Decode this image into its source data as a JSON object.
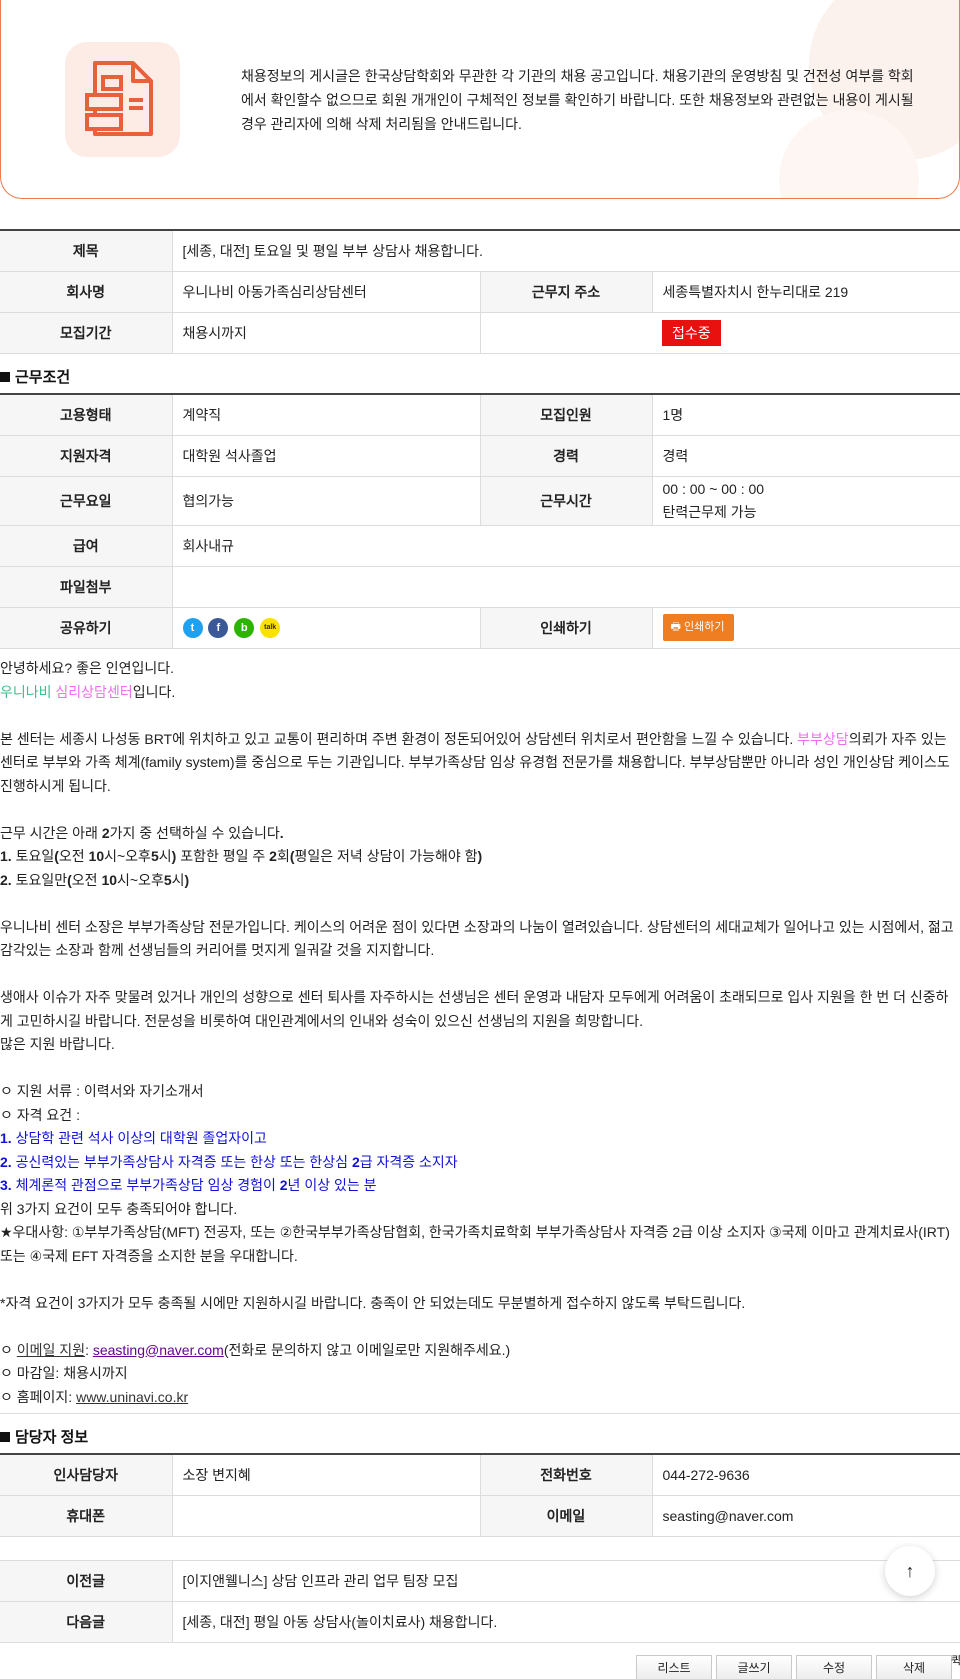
{
  "notice": {
    "icon": "document-list-icon",
    "text": "채용정보의 게시글은 한국상담학회와 무관한 각 기관의 채용 공고입니다. 채용기관의 운영방침 및 건전성 여부를 학회에서 확인할수 없으므로 회원 개개인이 구체적인 정보를 확인하기 바랍니다. 또한 채용정보와 관련없는 내용이 게시될 경우 관리자에 의해 삭제 처리됨을 안내드립니다."
  },
  "post": {
    "title_label": "제목",
    "title": "[세종, 대전] 토요일 및 평일 부부 상담사 채용합니다.",
    "company_label": "회사명",
    "company": "우니나비 아동가족심리상담센터",
    "address_label": "근무지 주소",
    "address": "세종특별자치시 한누리대로 219",
    "period_label": "모집기간",
    "period": "채용시까지",
    "status": "접수중",
    "status_color": "#e8110f"
  },
  "conditions": {
    "section_title": "근무조건",
    "employment_type_label": "고용형태",
    "employment_type": "계약직",
    "headcount_label": "모집인원",
    "headcount": "1명",
    "qualification_label": "지원자격",
    "qualification": "대학원 석사졸업",
    "career_label": "경력",
    "career": "경력",
    "workdays_label": "근무요일",
    "workdays": "협의가능",
    "worktime_label": "근무시간",
    "worktime": "00 : 00 ~ 00 : 00",
    "worktime_note": "탄력근무제 가능",
    "salary_label": "급여",
    "salary": "회사내규",
    "attachment_label": "파일첨부",
    "share_label": "공유하기",
    "share_icons": [
      "twitter-icon",
      "facebook-icon",
      "band-icon",
      "kakaotalk-icon"
    ],
    "print_label": "인쇄하기",
    "print_button": "인쇄하기",
    "print_color": "#ef7d22"
  },
  "body": {
    "greeting": "안녕하세요? 좋은 인연입니다.",
    "center_name_green": "우니나비",
    "center_name_pink": " 심리상담센터",
    "center_name_suffix": "입니다.",
    "intro_1": "본 센터는 세종시 나성동 BRT에 위치하고 있고 교통이 편리하며 주변 환경이 정돈되어있어 상담센터 위치로서 편안함을 느낄 수 있습니다. ",
    "intro_pink": "부부상담",
    "intro_2": "의뢰가 자주 있는 센터로 부부와 가족 체계(family system)를 중심으로 두는 기관입니다. 부부가족상담 임상 유경험 전문가를 채용합니다. 부부상담뿐만 아니라 성인 개인상담 케이스도 진행하시게 됩니다.",
    "hours_intro_a": "근무 시간은 아래 ",
    "hours_intro_b": "2",
    "hours_intro_c": "가지 중 선택하실 수 있습니다",
    "hours_intro_d": ".",
    "option1_a": "1. ",
    "option1_b": "토요일",
    "option1_c": "(",
    "option1_d": "오전 ",
    "option1_e": "10",
    "option1_f": "시~오후",
    "option1_g": "5",
    "option1_h": "시",
    "option1_i": ") ",
    "option1_j": "포함한 평일 주 ",
    "option1_k": "2",
    "option1_l": "회",
    "option1_m": "(",
    "option1_n": "평일은 저녁 상담이 가능해야 함",
    "option1_o": ")",
    "option2_a": "2. ",
    "option2_b": "토요일만",
    "option2_c": "(",
    "option2_d": "오전 ",
    "option2_e": "10",
    "option2_f": "시~오후",
    "option2_g": "5",
    "option2_h": "시",
    "option2_i": ")",
    "director": "우니나비 센터 소장은 부부가족상담 전문가입니다. 케이스의 어려운 점이 있다면 소장과의 나눔이 열려있습니다. 상담센터의 세대교체가 일어나고 있는 시점에서, 젊고 감각있는 소장과 함께 선생님들의 커리어를 멋지게 일궈갈 것을 지지합니다.",
    "caution": "생애사 이슈가 자주 맞물려 있거나 개인의 성향으로 센터 퇴사를 자주하시는 선생님은 센터 운영과 내담자 모두에게 어려움이 초래되므로 입사 지원을 한 번 더 신중하게 고민하시길 바랍니다. 전문성을 비롯하여 대인관계에서의 인내와 성숙이 있으신 선생님의 지원을 희망합니다.",
    "closing": "많은 지원 바랍니다.",
    "docs": "ㅇ 지원 서류 : 이력서와 자기소개서",
    "requirements_title": "ㅇ 자격 요건 :",
    "req1_num": "1.",
    "req1_text": " 상담학 관련 석사 이상의 대학원 졸업자이고",
    "req2_num": "2.",
    "req2_text_a": " 공신력있는 부부가족상담사 자격증 또는 한상 또는 한상심 ",
    "req2_text_b": "2",
    "req2_text_c": "급 자격증 소지자",
    "req3_num": "3.",
    "req3_text_a": " 체계론적 관점으로 부부가족상담 임상 경험이 ",
    "req3_text_b": "2",
    "req3_text_c": "년 이상 있는 분",
    "req_all": "위 3가지 요건이 모두 충족되어야 합니다.",
    "preference": "★우대사항: ①부부가족상담(MFT) 전공자, 또는 ②한국부부가족상담협회, 한국가족치료학회 부부가족상담사 자격증 2급 이상 소지자 ③국제 이마고 관계치료사(IRT) 또는 ④국제 EFT 자격증을 소지한 분을 우대합니다.",
    "note": "*자격 요건이 3가지가 모두 충족될 시에만 지원하시길 바랍니다. 충족이 안 되었는데도 무분별하게 접수하지 않도록 부탁드립니다.",
    "email_prefix": "ㅇ ",
    "email_label": "이메일 지원",
    "email_colon": ": ",
    "email_link": "seasting@naver.com",
    "email_note": "(전화로 문의하지 않고 이메일로만 지원해주세요.)",
    "deadline": "ㅇ 마감일: 채용시까지",
    "homepage_prefix": "ㅇ 홈페이지: ",
    "homepage_link": "www.uninavi.co.kr"
  },
  "contact": {
    "section_title": "담당자 정보",
    "hr_label": "인사담당자",
    "hr": "소장 변지혜",
    "phone_label": "전화번호",
    "phone": "044-272-9636",
    "mobile_label": "휴대폰",
    "mobile": "",
    "email_label": "이메일",
    "email": "seasting@naver.com"
  },
  "navigation": {
    "prev_label": "이전글",
    "prev": "[이지앤웰니스] 상담 인프라 관리 업무 팀장 모집",
    "next_label": "다음글",
    "next": "[세종, 대전] 평일 아동 상담사(놀이치료사) 채용합니다."
  },
  "buttons": {
    "list": "리스트",
    "write": "글쓰기",
    "edit": "수정",
    "delete": "삭제",
    "edge": "퀵"
  },
  "scroll_top_icon": "arrow-up-icon"
}
